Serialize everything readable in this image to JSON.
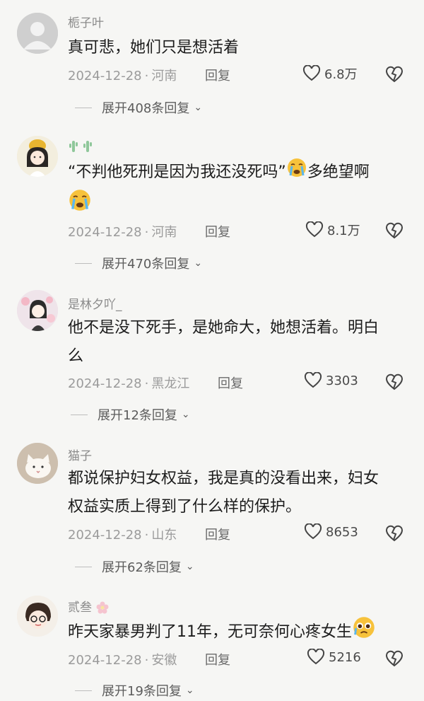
{
  "comments": [
    {
      "username": "栀子叶",
      "text": "真可悲，她们只是想活着",
      "date": "2024-12-28",
      "location": "河南",
      "reply_label": "回复",
      "likes": "6.8万",
      "expand": "展开408条回复"
    },
    {
      "username": "",
      "username_icon": "cactus-icon",
      "text_main": "“不判他死刑是因为我还没死吗”",
      "text_tail": "多绝望啊",
      "emoji": "crying-face-emoji",
      "date": "2024-12-28",
      "location": "河南",
      "reply_label": "回复",
      "likes": "8.1万",
      "expand": "展开470条回复"
    },
    {
      "username": "是林夕吖_",
      "text_line1": "他不是没下死手，是她命大，她想活着。明白",
      "text_line2": "么",
      "date": "2024-12-28",
      "location": "黑龙江",
      "reply_label": "回复",
      "likes": "3303",
      "expand": "展开12条回复"
    },
    {
      "username": "猫子",
      "text_line1": "都说保护妇女权益，我是真的没看出来，妇女",
      "text_line2": "权益实质上得到了什么样的保护。",
      "date": "2024-12-28",
      "location": "山东",
      "reply_label": "回复",
      "likes": "8653",
      "expand": "展开62条回复"
    },
    {
      "username": "贰叁",
      "username_icon": "flower-icon",
      "text": "昨天家暴男判了11年，无可奈何心疼女生",
      "emoji": "pleading-face-emoji",
      "date": "2024-12-28",
      "location": "安徽",
      "reply_label": "回复",
      "likes": "5216",
      "expand": "展开19条回复"
    }
  ],
  "icons": {
    "like": "heart-outline-icon",
    "dislike": "broken-heart-icon",
    "expand": "chevron-down-icon"
  }
}
